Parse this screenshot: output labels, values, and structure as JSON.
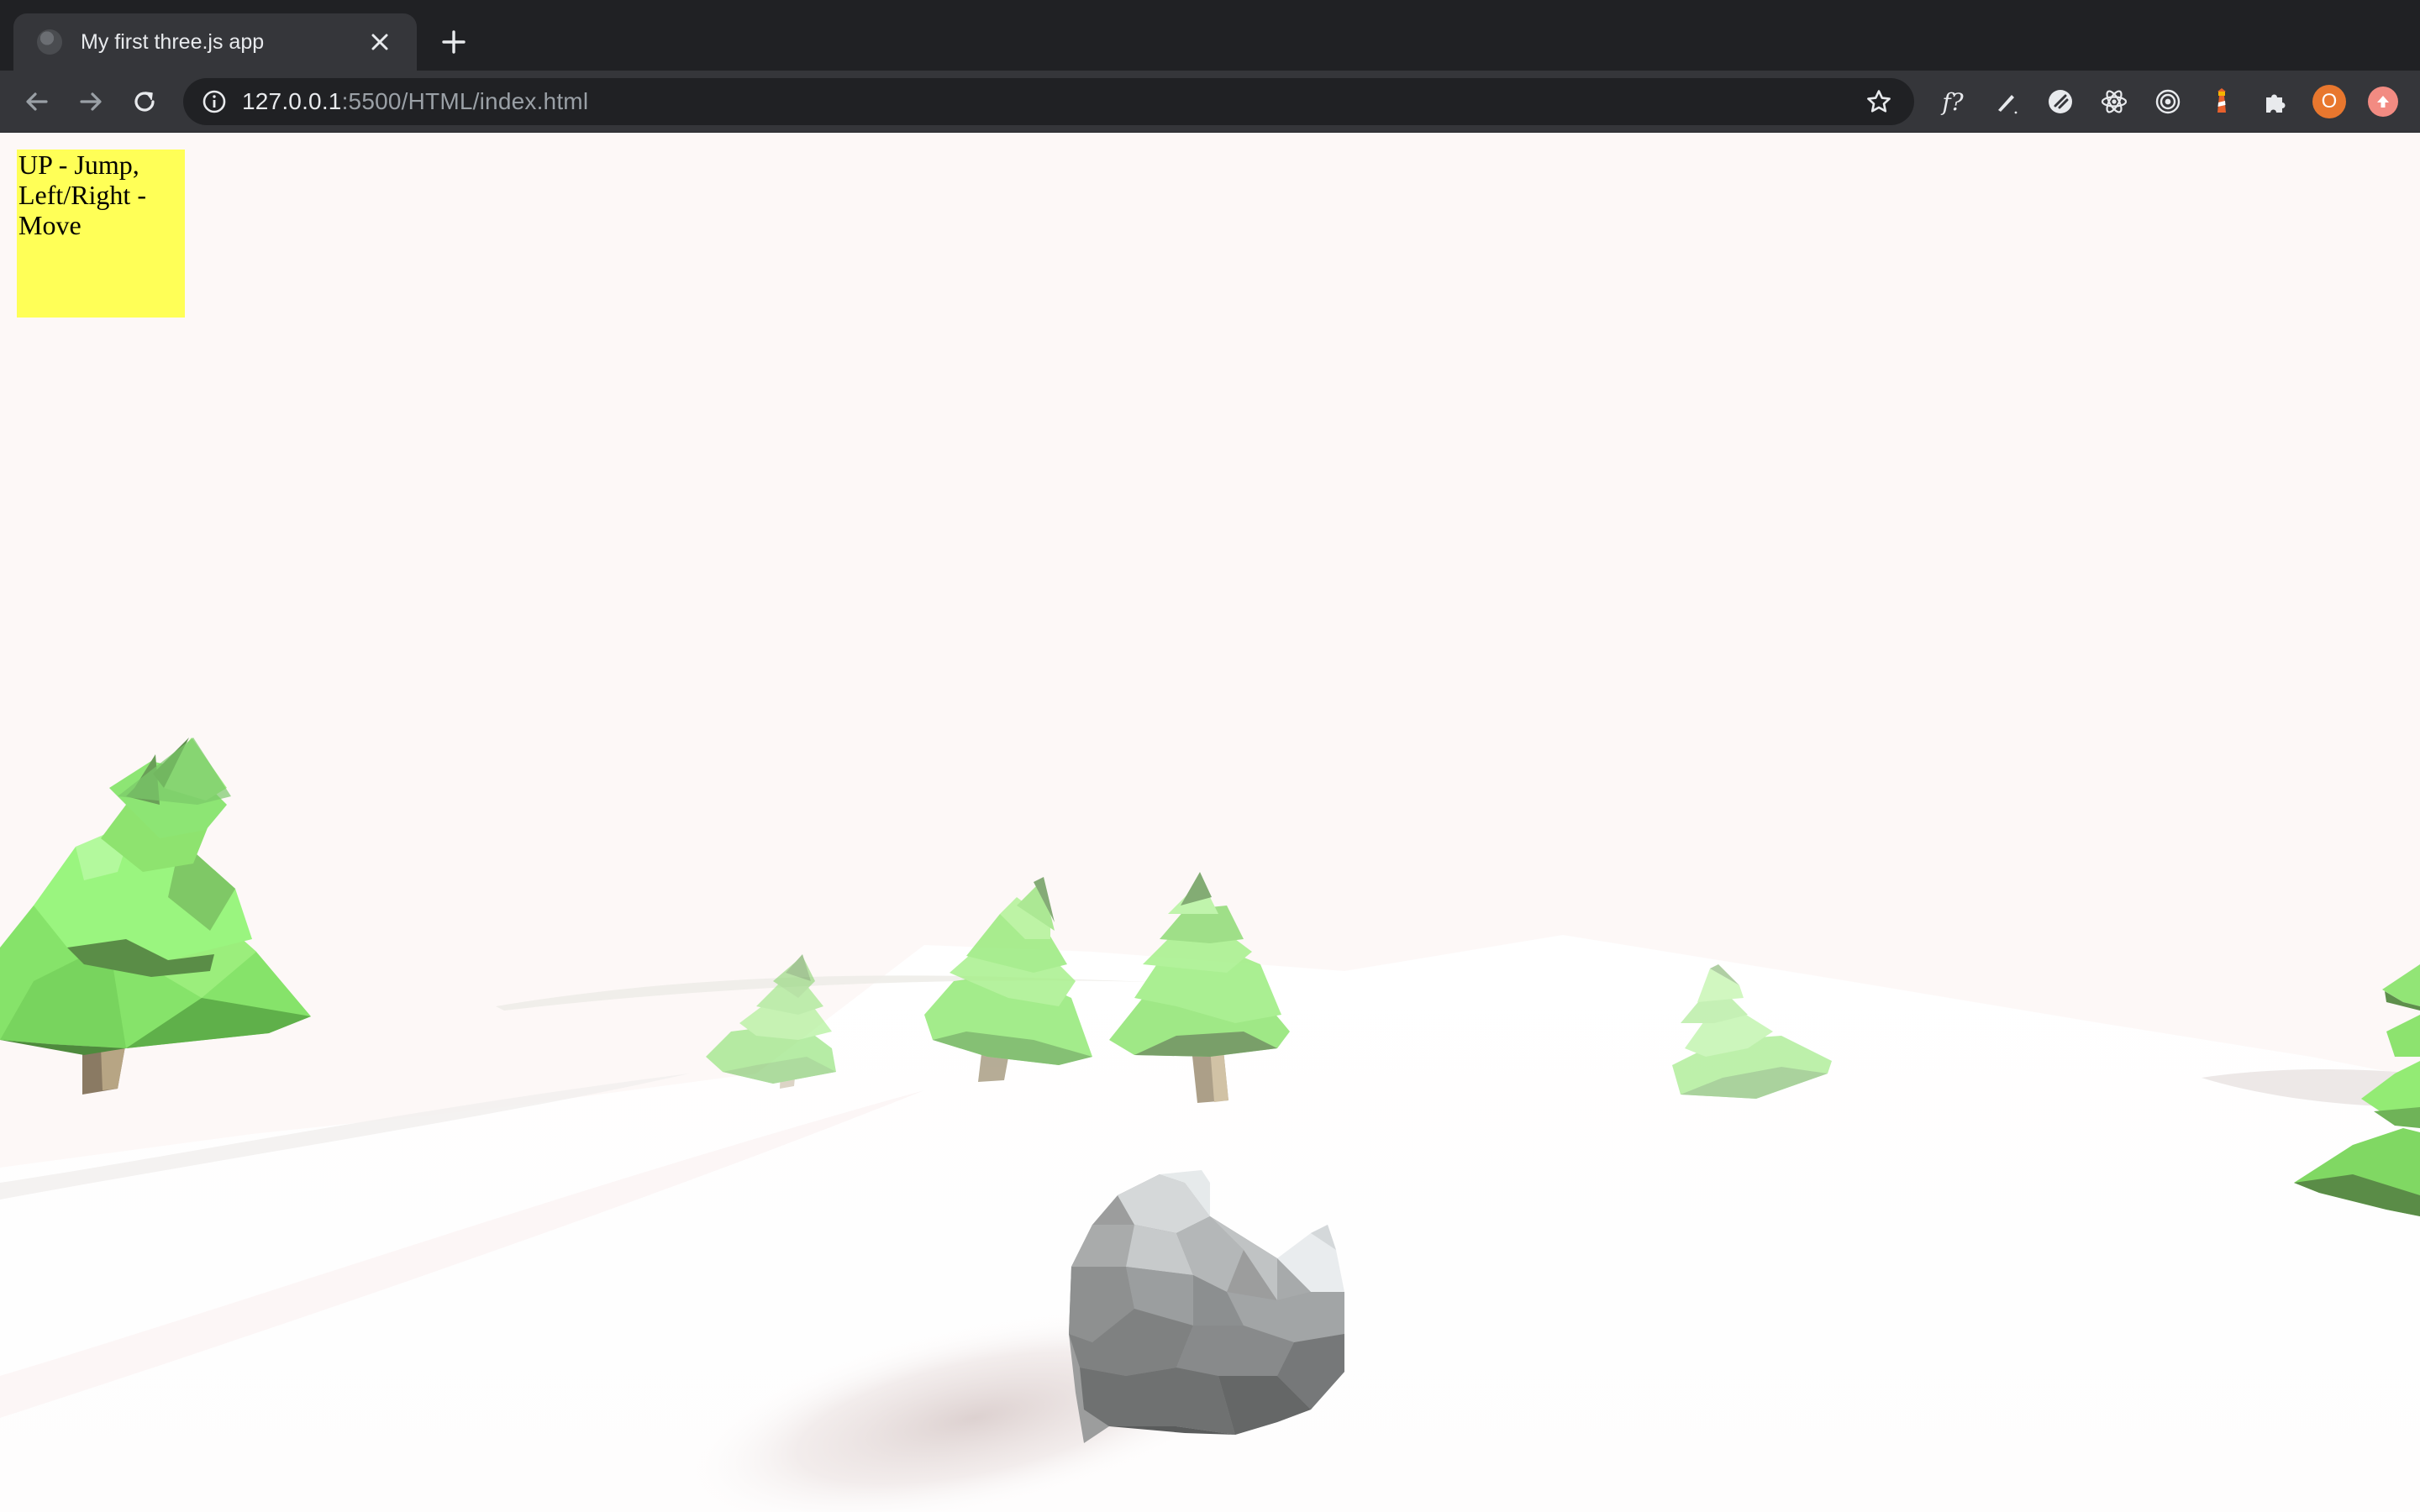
{
  "browser": {
    "tab": {
      "title": "My first three.js app",
      "favicon": "globe-icon",
      "close_icon": "close-icon"
    },
    "new_tab_icon": "plus-icon",
    "nav": {
      "back_icon": "arrow-left-icon",
      "forward_icon": "arrow-right-icon",
      "reload_icon": "reload-icon"
    },
    "address_bar": {
      "site_info_icon": "info-icon",
      "url_host": "127.0.0.1",
      "url_rest": ":5500/HTML/index.html",
      "bookmark_icon": "star-icon"
    },
    "extensions": [
      {
        "name": "function-icon",
        "label": "f?"
      },
      {
        "name": "pen-icon"
      },
      {
        "name": "magnet-icon"
      },
      {
        "name": "react-atom-icon"
      },
      {
        "name": "target-icon"
      },
      {
        "name": "lighthouse-icon"
      },
      {
        "name": "puzzle-icon"
      }
    ],
    "profile": {
      "initial": "O",
      "color": "#e8772e"
    },
    "update_icon": "arrow-up-icon"
  },
  "page": {
    "instructions": "UP - Jump, Left/Right - Move",
    "background_color": "#fdf8f7",
    "instruction_box_color": "#ffff57"
  },
  "scene": {
    "objects": [
      "pine-tree",
      "pine-tree",
      "pine-tree",
      "pine-tree",
      "pine-tree",
      "pine-tree",
      "rolling-snowball-hero"
    ]
  }
}
